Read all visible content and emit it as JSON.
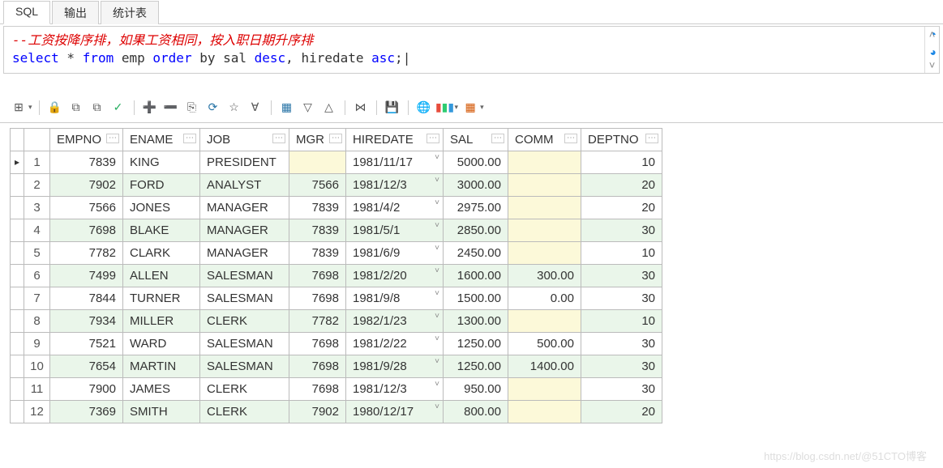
{
  "tabs": {
    "sql": "SQL",
    "output": "输出",
    "stats": "统计表"
  },
  "sql": {
    "comment": "--工资按降序排，如果工资相同，按入职日期升序排",
    "tokens": {
      "select": "select",
      "star": " * ",
      "from": "from",
      "emp": " emp ",
      "order": "order",
      "by": " by ",
      "sal": " sal ",
      "desc": "desc",
      "comma": ", ",
      "hiredate": "hiredate ",
      "asc": "asc",
      "end": ";"
    }
  },
  "columns": {
    "empno": "EMPNO",
    "ename": "ENAME",
    "job": "JOB",
    "mgr": "MGR",
    "hiredate": "HIREDATE",
    "sal": "SAL",
    "comm": "COMM",
    "deptno": "DEPTNO"
  },
  "rows": [
    {
      "n": "1",
      "empno": "7839",
      "ename": "KING",
      "job": "PRESIDENT",
      "mgr": "",
      "hiredate": "1981/11/17",
      "sal": "5000.00",
      "comm": "",
      "deptno": "10",
      "hlMgr": true,
      "hlComm": true
    },
    {
      "n": "2",
      "empno": "7902",
      "ename": "FORD",
      "job": "ANALYST",
      "mgr": "7566",
      "hiredate": "1981/12/3",
      "sal": "3000.00",
      "comm": "",
      "deptno": "20",
      "hlComm": true
    },
    {
      "n": "3",
      "empno": "7566",
      "ename": "JONES",
      "job": "MANAGER",
      "mgr": "7839",
      "hiredate": "1981/4/2",
      "sal": "2975.00",
      "comm": "",
      "deptno": "20",
      "hlComm": true
    },
    {
      "n": "4",
      "empno": "7698",
      "ename": "BLAKE",
      "job": "MANAGER",
      "mgr": "7839",
      "hiredate": "1981/5/1",
      "sal": "2850.00",
      "comm": "",
      "deptno": "30",
      "hlComm": true
    },
    {
      "n": "5",
      "empno": "7782",
      "ename": "CLARK",
      "job": "MANAGER",
      "mgr": "7839",
      "hiredate": "1981/6/9",
      "sal": "2450.00",
      "comm": "",
      "deptno": "10",
      "hlComm": true
    },
    {
      "n": "6",
      "empno": "7499",
      "ename": "ALLEN",
      "job": "SALESMAN",
      "mgr": "7698",
      "hiredate": "1981/2/20",
      "sal": "1600.00",
      "comm": "300.00",
      "deptno": "30"
    },
    {
      "n": "7",
      "empno": "7844",
      "ename": "TURNER",
      "job": "SALESMAN",
      "mgr": "7698",
      "hiredate": "1981/9/8",
      "sal": "1500.00",
      "comm": "0.00",
      "deptno": "30"
    },
    {
      "n": "8",
      "empno": "7934",
      "ename": "MILLER",
      "job": "CLERK",
      "mgr": "7782",
      "hiredate": "1982/1/23",
      "sal": "1300.00",
      "comm": "",
      "deptno": "10",
      "hlComm": true
    },
    {
      "n": "9",
      "empno": "7521",
      "ename": "WARD",
      "job": "SALESMAN",
      "mgr": "7698",
      "hiredate": "1981/2/22",
      "sal": "1250.00",
      "comm": "500.00",
      "deptno": "30"
    },
    {
      "n": "10",
      "empno": "7654",
      "ename": "MARTIN",
      "job": "SALESMAN",
      "mgr": "7698",
      "hiredate": "1981/9/28",
      "sal": "1250.00",
      "comm": "1400.00",
      "deptno": "30"
    },
    {
      "n": "11",
      "empno": "7900",
      "ename": "JAMES",
      "job": "CLERK",
      "mgr": "7698",
      "hiredate": "1981/12/3",
      "sal": "950.00",
      "comm": "",
      "deptno": "30",
      "hlComm": true
    },
    {
      "n": "12",
      "empno": "7369",
      "ename": "SMITH",
      "job": "CLERK",
      "mgr": "7902",
      "hiredate": "1980/12/17",
      "sal": "800.00",
      "comm": "",
      "deptno": "20",
      "hlComm": true
    }
  ],
  "watermark": "https://blog.csdn.net/@51CTO博客"
}
